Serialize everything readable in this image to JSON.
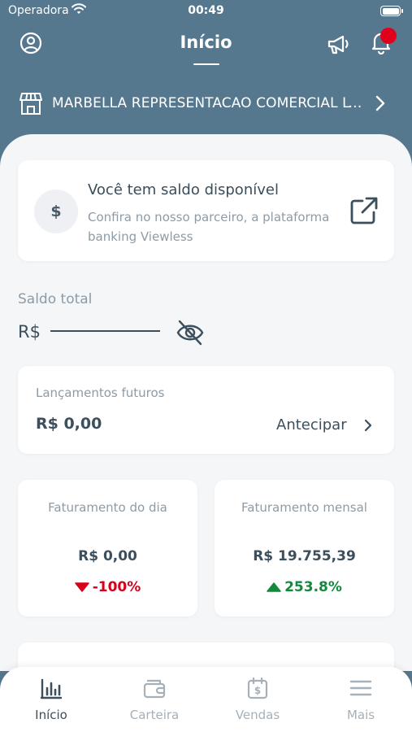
{
  "status_bar": {
    "carrier": "Operadora",
    "time": "00:49"
  },
  "header": {
    "title": "Início"
  },
  "company": {
    "name": "MARBELLA REPRESENTACAO COMERCIAL LTDA"
  },
  "balance_card": {
    "icon_symbol": "$",
    "title": "Você tem saldo disponível",
    "subtitle": "Confira no nosso parceiro, a plataforma banking Viewless"
  },
  "saldo": {
    "label": "Saldo total",
    "currency": "R$"
  },
  "future": {
    "label": "Lançamentos futuros",
    "value": "R$ 0,00",
    "action": "Antecipar"
  },
  "stats": [
    {
      "title": "Faturamento do dia",
      "value": "R$ 0,00",
      "change": "-100%",
      "direction": "down"
    },
    {
      "title": "Faturamento mensal",
      "value": "R$ 19.755,39",
      "change": "253.8%",
      "direction": "up"
    }
  ],
  "tabs": [
    {
      "label": "Início",
      "icon": "chart-bars-icon"
    },
    {
      "label": "Carteira",
      "icon": "wallet-icon"
    },
    {
      "label": "Vendas",
      "icon": "calendar-dollar-icon"
    },
    {
      "label": "Mais",
      "icon": "menu-icon"
    }
  ],
  "colors": {
    "header_bg": "#55788e",
    "negative": "#d6001c",
    "positive": "#128a3c",
    "notification": "#e0001b"
  }
}
